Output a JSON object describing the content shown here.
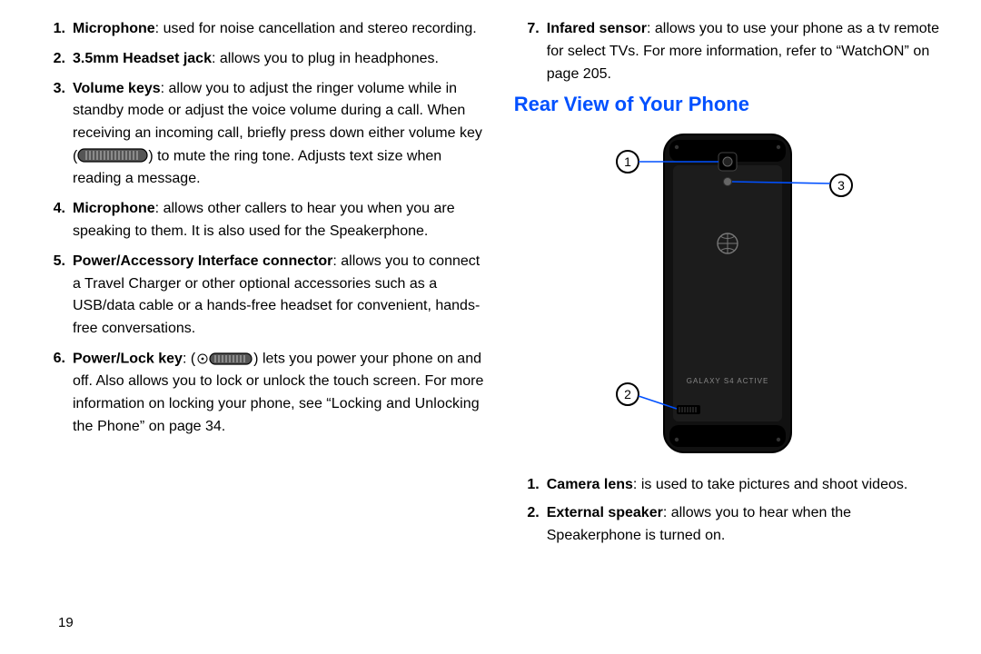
{
  "pageNumber": "19",
  "left": {
    "start": 1,
    "items": [
      {
        "term": "Microphone",
        "desc": ": used for noise cancellation and stereo recording."
      },
      {
        "term": "3.5mm Headset jack",
        "desc": ": allows you to plug in headphones."
      },
      {
        "term": "Volume keys",
        "descBefore": ": allow you to adjust the ringer volume while in standby mode or adjust the voice volume during a call. When receiving an incoming call, briefly press down either volume key (",
        "icon": "volume-key",
        "descAfter": ") to mute the ring tone. Adjusts text size when reading a message."
      },
      {
        "term": "Microphone",
        "desc": ": allows other callers to hear you when you are speaking to them. It is also used for the Speakerphone."
      },
      {
        "term": "Power/Accessory Interface connector",
        "desc": ": allows you to connect a Travel Charger or other optional accessories such as a USB/data cable or a hands-free headset for convenient, hands-free conversations."
      },
      {
        "term": "Power/Lock key",
        "descBefore": ": (",
        "icon": "power-lock-key",
        "descAfter": ") lets you power your phone on and off. Also allows you to lock or unlock the touch screen. For more information on locking your phone, see ",
        "xref": "“Locking and Unlocking the Phone”",
        "descTail": " on page 34."
      }
    ]
  },
  "right": {
    "start": 7,
    "topItems": [
      {
        "term": "Infared sensor",
        "descBefore": ": allows you to use your phone as a tv remote for select TVs. For more information, refer to ",
        "xref": "“WatchON”",
        "descTail": " on page 205."
      }
    ],
    "heading": "Rear View of Your Phone",
    "diagram": {
      "callouts": [
        "1",
        "2",
        "3"
      ],
      "brandingLine": "GALAXY S4 ACTIVE"
    },
    "rearItems": [
      {
        "term": "Camera lens",
        "desc": ": is used to take pictures and shoot videos."
      },
      {
        "term": "External speaker",
        "desc": ": allows you to hear when the Speakerphone is turned on."
      }
    ]
  }
}
